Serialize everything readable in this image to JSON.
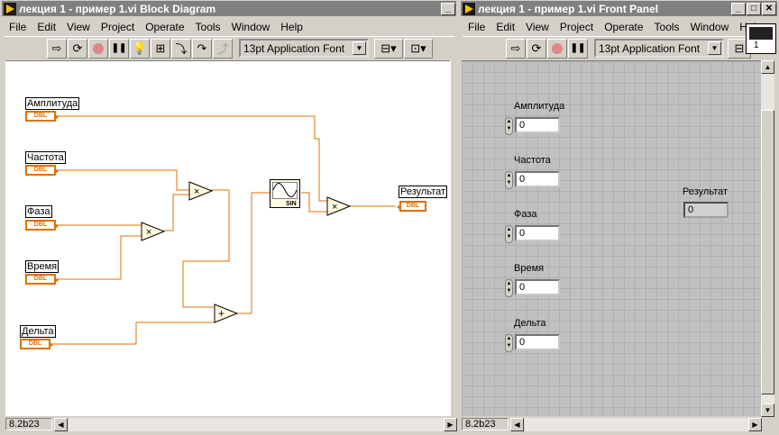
{
  "block_diagram": {
    "title": "лекция 1 - пример 1.vi Block Diagram",
    "menu": [
      "File",
      "Edit",
      "View",
      "Project",
      "Operate",
      "Tools",
      "Window",
      "Help"
    ],
    "font_selector": "13pt Application Font",
    "controls": [
      {
        "label": "Амплитуда",
        "type": "DBL"
      },
      {
        "label": "Частота",
        "type": "DBL"
      },
      {
        "label": "Фаза",
        "type": "DBL"
      },
      {
        "label": "Время",
        "type": "DBL"
      },
      {
        "label": "Дельта",
        "type": "DBL"
      }
    ],
    "indicator": {
      "label": "Результат",
      "type": "DBL"
    },
    "sin_label": "SIN",
    "multiply_symbol": "×",
    "add_symbol": "+",
    "status": "8.2b23"
  },
  "front_panel": {
    "title": "лекция 1 - пример 1.vi Front Panel",
    "menu": [
      "File",
      "Edit",
      "View",
      "Project",
      "Operate",
      "Tools",
      "Window",
      "Help"
    ],
    "font_selector": "13pt Application Font",
    "controls": [
      {
        "label": "Амплитуда",
        "value": "0"
      },
      {
        "label": "Частота",
        "value": "0"
      },
      {
        "label": "Фаза",
        "value": "0"
      },
      {
        "label": "Время",
        "value": "0"
      },
      {
        "label": "Дельта",
        "value": "0"
      }
    ],
    "indicator": {
      "label": "Результат",
      "value": "0"
    },
    "connector_number": "1",
    "status": "8.2b23"
  },
  "colors": {
    "wire": "#e07000",
    "title_inactive": "#808080",
    "panel_bg": "#c0c0c0"
  }
}
